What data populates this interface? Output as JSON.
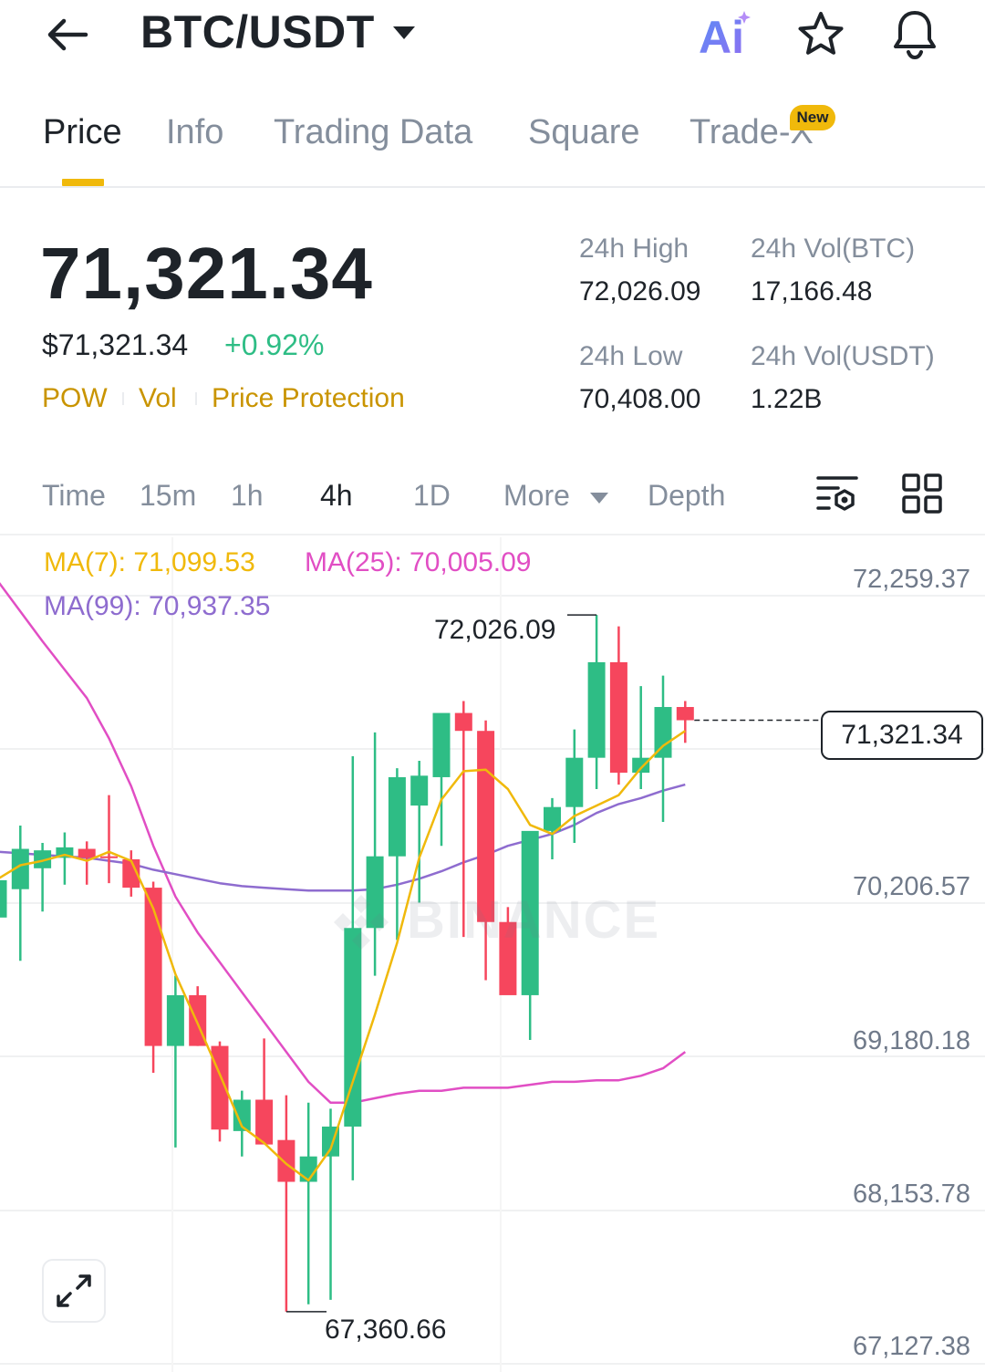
{
  "header": {
    "pair": "BTC/USDT",
    "icons": [
      "back-arrow-icon",
      "chevron-down-icon",
      "ai-icon",
      "star-icon",
      "bell-icon"
    ],
    "ai_label": "Ai"
  },
  "tabs": [
    {
      "label": "Price",
      "active": true
    },
    {
      "label": "Info",
      "active": false
    },
    {
      "label": "Trading Data",
      "active": false
    },
    {
      "label": "Square",
      "active": false
    },
    {
      "label": "Trade-X",
      "active": false,
      "badge": "New"
    }
  ],
  "ticker": {
    "last_price": "71,321.34",
    "usd_price": "$71,321.34",
    "change_pct": "+0.92%",
    "tags": [
      "POW",
      "Vol",
      "Price Protection"
    ],
    "stats": {
      "high_label": "24h High",
      "high_value": "72,026.09",
      "vol_btc_label": "24h Vol(BTC)",
      "vol_btc_value": "17,166.48",
      "low_label": "24h Low",
      "low_value": "70,408.00",
      "vol_usdt_label": "24h Vol(USDT)",
      "vol_usdt_value": "1.22B"
    }
  },
  "intervals": {
    "items": [
      "Time",
      "15m",
      "1h",
      "4h",
      "1D",
      "More",
      "Depth"
    ],
    "active": "4h"
  },
  "chart": {
    "ma7": "MA(7): 71,099.53",
    "ma25": "MA(25): 70,005.09",
    "ma99": "MA(99): 70,937.35",
    "price_axis": [
      "72,259.37",
      "70,206.57",
      "69,180.18",
      "68,153.78",
      "67,127.38"
    ],
    "current_price": "71,321.34",
    "high_marker": "72,026.09",
    "low_marker": "67,360.66",
    "watermark": "BINANCE",
    "colors": {
      "up": "#2ebd85",
      "down": "#f6465d",
      "ma7": "#f0b90b",
      "ma25": "#e14ec4",
      "ma99": "#8e6ccf",
      "accent": "#f0b90b"
    }
  },
  "chart_data": {
    "type": "candlestick",
    "symbol": "BTC/USDT",
    "interval": "4h",
    "ylim": [
      67127.38,
      72259.37
    ],
    "candles": [
      {
        "o": 70000,
        "h": 70320,
        "l": 69780,
        "c": 70250
      },
      {
        "o": 70190,
        "h": 70616,
        "l": 69710,
        "c": 70460
      },
      {
        "o": 70330,
        "h": 70500,
        "l": 70040,
        "c": 70450
      },
      {
        "o": 70400,
        "h": 70570,
        "l": 70220,
        "c": 70470
      },
      {
        "o": 70460,
        "h": 70510,
        "l": 70220,
        "c": 70400
      },
      {
        "o": 70410,
        "h": 70820,
        "l": 70230,
        "c": 70400
      },
      {
        "o": 70390,
        "h": 70450,
        "l": 70140,
        "c": 70200
      },
      {
        "o": 70200,
        "h": 70240,
        "l": 68960,
        "c": 69140
      },
      {
        "o": 69140,
        "h": 69610,
        "l": 68460,
        "c": 69480
      },
      {
        "o": 69480,
        "h": 69540,
        "l": 69140,
        "c": 69140
      },
      {
        "o": 69140,
        "h": 69170,
        "l": 68500,
        "c": 68580
      },
      {
        "o": 68570,
        "h": 68840,
        "l": 68400,
        "c": 68780
      },
      {
        "o": 68780,
        "h": 69190,
        "l": 68580,
        "c": 68480
      },
      {
        "o": 68510,
        "h": 68810,
        "l": 67360.66,
        "c": 68230
      },
      {
        "o": 68230,
        "h": 68760,
        "l": 67410,
        "c": 68400
      },
      {
        "o": 68400,
        "h": 68720,
        "l": 67440,
        "c": 68600
      },
      {
        "o": 68600,
        "h": 71080,
        "l": 68240,
        "c": 69930
      },
      {
        "o": 69930,
        "h": 71240,
        "l": 69610,
        "c": 70410
      },
      {
        "o": 70410,
        "h": 71000,
        "l": 69850,
        "c": 70940
      },
      {
        "o": 70750,
        "h": 71050,
        "l": 70100,
        "c": 70950
      },
      {
        "o": 70940,
        "h": 71210,
        "l": 70480,
        "c": 71370
      },
      {
        "o": 71370,
        "h": 71450,
        "l": 69870,
        "c": 71250
      },
      {
        "o": 71250,
        "h": 71320,
        "l": 69580,
        "c": 69970
      },
      {
        "o": 69970,
        "h": 70070,
        "l": 69760,
        "c": 69480
      },
      {
        "o": 69480,
        "h": 70540,
        "l": 69180,
        "c": 70580
      },
      {
        "o": 70580,
        "h": 70800,
        "l": 70390,
        "c": 70740
      },
      {
        "o": 70740,
        "h": 71260,
        "l": 70500,
        "c": 71070
      },
      {
        "o": 71070,
        "h": 72026.09,
        "l": 70860,
        "c": 71710
      },
      {
        "o": 71710,
        "h": 71950,
        "l": 70890,
        "c": 70970
      },
      {
        "o": 70970,
        "h": 71550,
        "l": 70860,
        "c": 71070
      },
      {
        "o": 71070,
        "h": 71620,
        "l": 70640,
        "c": 71410
      },
      {
        "o": 71410,
        "h": 71450,
        "l": 71170,
        "c": 71321.34
      }
    ],
    "ma7": [
      70260,
      70350,
      70380,
      70420,
      70380,
      70440,
      70380,
      70060,
      69620,
      69290,
      68950,
      68600,
      68490,
      68350,
      68240,
      68450,
      68900,
      69350,
      69830,
      70400,
      70790,
      70980,
      70990,
      70860,
      70620,
      70560,
      70680,
      70750,
      70820,
      71000,
      71150,
      71250
    ],
    "ma25": [
      72250,
      72050,
      71850,
      71660,
      71470,
      71200,
      70880,
      70480,
      70140,
      69900,
      69700,
      69500,
      69300,
      69100,
      68900,
      68760,
      68760,
      68790,
      68820,
      68840,
      68840,
      68860,
      68860,
      68860,
      68880,
      68900,
      68900,
      68910,
      68910,
      68940,
      68990,
      69100
    ],
    "ma99": [
      70440,
      70430,
      70420,
      70410,
      70400,
      70380,
      70360,
      70320,
      70290,
      70260,
      70230,
      70210,
      70200,
      70190,
      70180,
      70180,
      70180,
      70190,
      70220,
      70260,
      70310,
      70370,
      70420,
      70480,
      70520,
      70560,
      70620,
      70700,
      70760,
      70800,
      70850,
      70890
    ]
  }
}
